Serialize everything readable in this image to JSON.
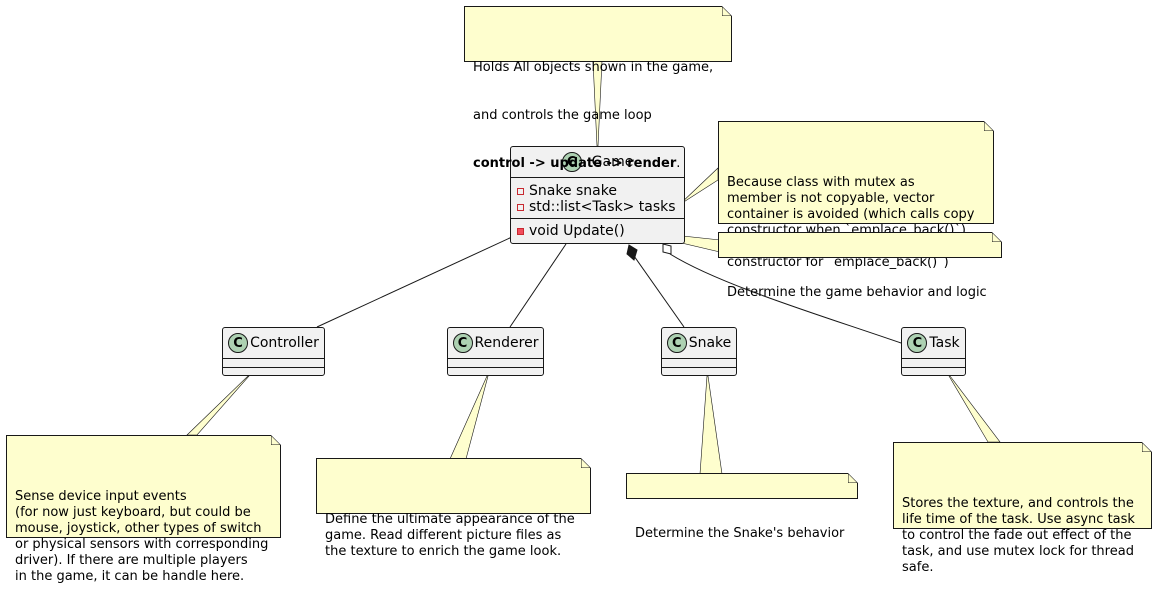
{
  "classes": {
    "game": {
      "name": "Game",
      "stereotype_letter": "C",
      "fields": [
        {
          "visibility": "private",
          "text": "Snake snake"
        },
        {
          "visibility": "private",
          "text": "std::list<Task> tasks"
        }
      ],
      "methods": [
        {
          "visibility": "private",
          "text": "void Update()"
        }
      ]
    },
    "controller": {
      "name": "Controller",
      "stereotype_letter": "C"
    },
    "renderer": {
      "name": "Renderer",
      "stereotype_letter": "C"
    },
    "snake": {
      "name": "Snake",
      "stereotype_letter": "C"
    },
    "task": {
      "name": "Task",
      "stereotype_letter": "C"
    }
  },
  "relations": [
    {
      "from": "Game",
      "to": "Controller",
      "type": "association"
    },
    {
      "from": "Game",
      "to": "Renderer",
      "type": "association"
    },
    {
      "from": "Game",
      "to": "Snake",
      "type": "composition"
    },
    {
      "from": "Game",
      "to": "Task",
      "type": "aggregation"
    }
  ],
  "notes": {
    "game_top": {
      "lines": [
        "Holds All objects shown in the game,",
        "and controls the game loop"
      ],
      "bold_text": "control -> update -> render",
      "bold_suffix": "."
    },
    "tasks_field": {
      "text": "Because class with mutex as\nmember is not copyable, vector\ncontainer is avoided (which calls copy\nconstructor when `emplace_back()`),\ninstead, a list is used (calls\nconstructor for `emplace_back()`)"
    },
    "update_method": {
      "text": "Determine the game behavior and logic"
    },
    "controller": {
      "text": "Sense device input events\n(for now just keyboard, but could be\nmouse, joystick, other types of switch\nor physical sensors with corresponding\ndriver). If there are multiple players\nin the game, it can be handle here."
    },
    "renderer": {
      "text": "Define the ultimate appearance of the\ngame. Read different picture files as\nthe texture to enrich the game look."
    },
    "snake": {
      "text": "Determine the Snake's behavior"
    },
    "task": {
      "text": "Stores the texture, and controls the\nlife time of the task. Use async task\nto control the fade out effect of the\ntask, and use mutex lock for thread\nsafe."
    }
  }
}
